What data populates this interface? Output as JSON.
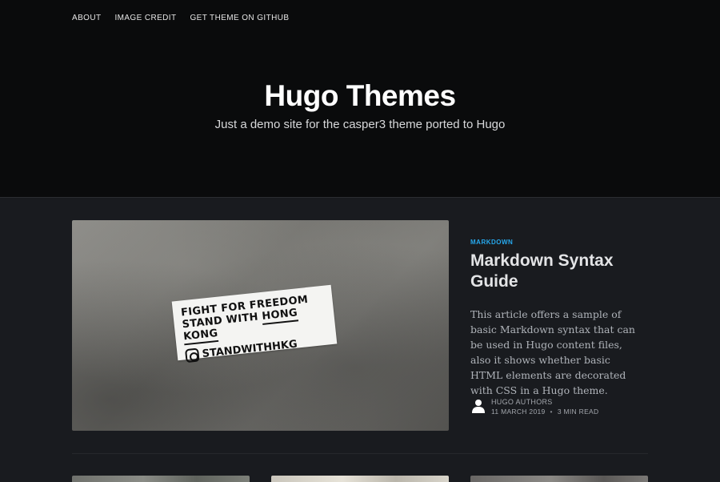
{
  "nav": {
    "items": [
      {
        "label": "ABOUT"
      },
      {
        "label": "IMAGE CREDIT"
      },
      {
        "label": "GET THEME ON GITHUB"
      }
    ]
  },
  "site": {
    "title": "Hugo Themes",
    "description": "Just a demo site for the casper3 theme ported to Hugo"
  },
  "featured_post": {
    "image": {
      "sticker_line1": "FIGHT FOR FREEDOM",
      "sticker_line2_prefix": "STAND WITH",
      "sticker_line2_emph": "HONG KONG",
      "sticker_line3": "STANDWITHHKG",
      "sticker_icon": "instagram-icon"
    },
    "tag": "MARKDOWN",
    "title": "Markdown Syntax Guide",
    "excerpt": "This article offers a sample of basic Markdown syntax that can be used in Hugo content files, also it shows whether basic HTML elements are decorated with CSS in a Hugo theme.",
    "author": "HUGO AUTHORS",
    "date": "11 MARCH 2019",
    "separator": "•",
    "reading_time": "3 MIN READ",
    "avatar_icon": "user-avatar-icon"
  },
  "colors": {
    "header_bg": "#0a0b0c",
    "page_bg": "#191b1f",
    "tag_blue": "#26a8ed"
  }
}
